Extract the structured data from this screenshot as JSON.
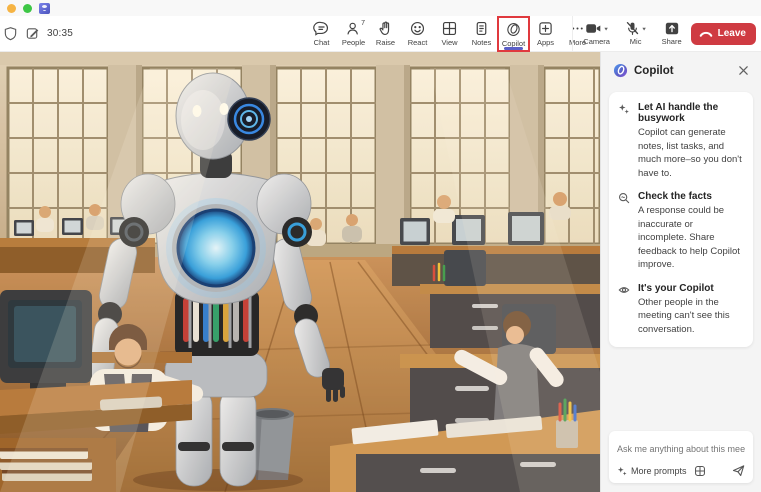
{
  "titlebar": {
    "app_icon": "teams-logo"
  },
  "toolbar": {
    "timer": "30:35",
    "items": [
      {
        "label": "Chat",
        "icon": "chat-icon"
      },
      {
        "label": "People",
        "icon": "people-icon",
        "badge": "7"
      },
      {
        "label": "Raise",
        "icon": "raise-hand-icon"
      },
      {
        "label": "React",
        "icon": "react-icon"
      },
      {
        "label": "View",
        "icon": "view-icon"
      },
      {
        "label": "Notes",
        "icon": "notes-icon"
      },
      {
        "label": "Copilot",
        "icon": "copilot-icon",
        "highlighted": true,
        "selected": true
      },
      {
        "label": "Apps",
        "icon": "apps-icon"
      },
      {
        "label": "More",
        "icon": "more-icon"
      }
    ],
    "device_controls": [
      {
        "label": "Camera",
        "icon": "camera-icon"
      },
      {
        "label": "Mic",
        "icon": "mic-muted-icon",
        "muted": true
      },
      {
        "label": "Share",
        "icon": "share-icon"
      }
    ],
    "leave_label": "Leave"
  },
  "copilot_panel": {
    "title": "Copilot",
    "tips": [
      {
        "icon": "sparkles-icon",
        "title": "Let AI handle the busywork",
        "body": "Copilot can generate notes, list tasks, and much more–so you don't have to."
      },
      {
        "icon": "search-icon",
        "title": "Check the facts",
        "body": "A response could be inaccurate or incomplete. Share feedback to help Copilot improve."
      },
      {
        "icon": "eye-off-icon",
        "title": "It's your Copilot",
        "body": "Other people in the meeting can't see this conversation."
      }
    ],
    "composer": {
      "placeholder": "Ask me anything about this meeting",
      "more_prompts_label": "More prompts"
    }
  },
  "colors": {
    "accent_purple": "#5b5fc7",
    "leave_red": "#cf3b42",
    "highlight_red": "#e0393e",
    "panel_bg": "#f4f4f4",
    "copilot_blue": "#4f9cf0",
    "copilot_purple": "#8456d6",
    "robot_core_blue": "#2f9fe0"
  }
}
